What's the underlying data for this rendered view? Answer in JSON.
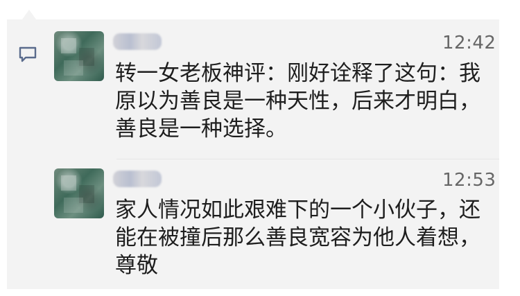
{
  "comments": [
    {
      "time": "12:42",
      "text": "转一女老板神评：刚好诠释了这句：我原以为善良是一种天性，后来才明白，善良是一种选择。"
    },
    {
      "time": "12:53",
      "text": "家人情况如此艰难下的一个小伙子，还能在被撞后那么善良宽容为他人着想，尊敬"
    }
  ],
  "icons": {
    "comment": "comment-icon"
  },
  "colors": {
    "card_background": "#f3f3f3",
    "accent": "#5a6b8c"
  }
}
